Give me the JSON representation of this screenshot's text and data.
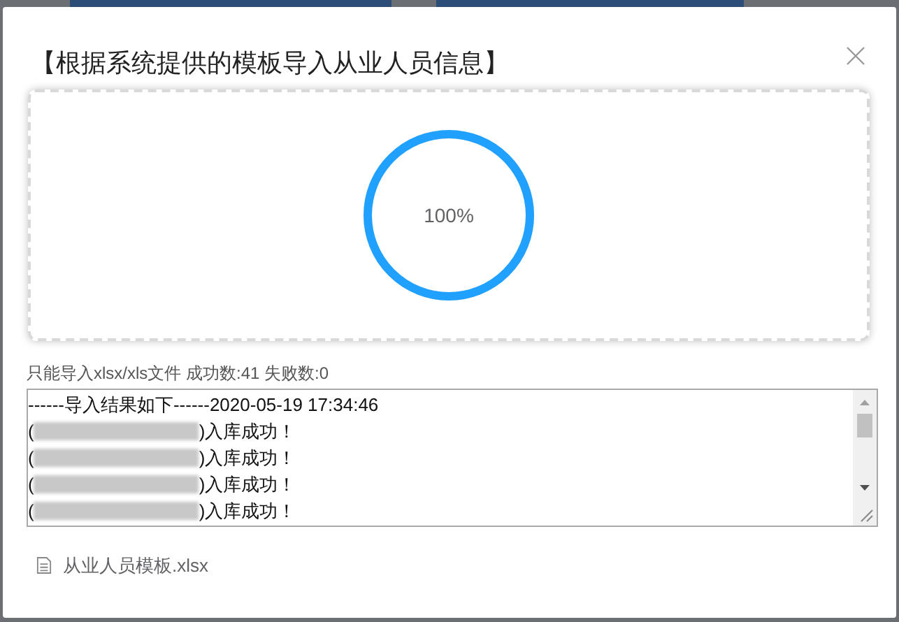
{
  "dialog": {
    "title": "【根据系统提供的模板导入从业人员信息】",
    "upload": {
      "level": 1,
      "reading": "100%"
    },
    "summary": "只能导入xlsx/xls文件 成功数:41 失败数:0",
    "log": {
      "header": "------导入结果如下------2020-05-19 17:34:46",
      "lines": [
        {
          "prefix": "(",
          "suffix": ")入库成功！"
        },
        {
          "prefix": "(",
          "suffix": ")入库成功！"
        },
        {
          "prefix": "(",
          "suffix": ")入库成功！"
        },
        {
          "prefix": "(",
          "suffix": ")入库成功！"
        }
      ]
    },
    "file": {
      "name": "从业人员模板.xlsx"
    }
  }
}
